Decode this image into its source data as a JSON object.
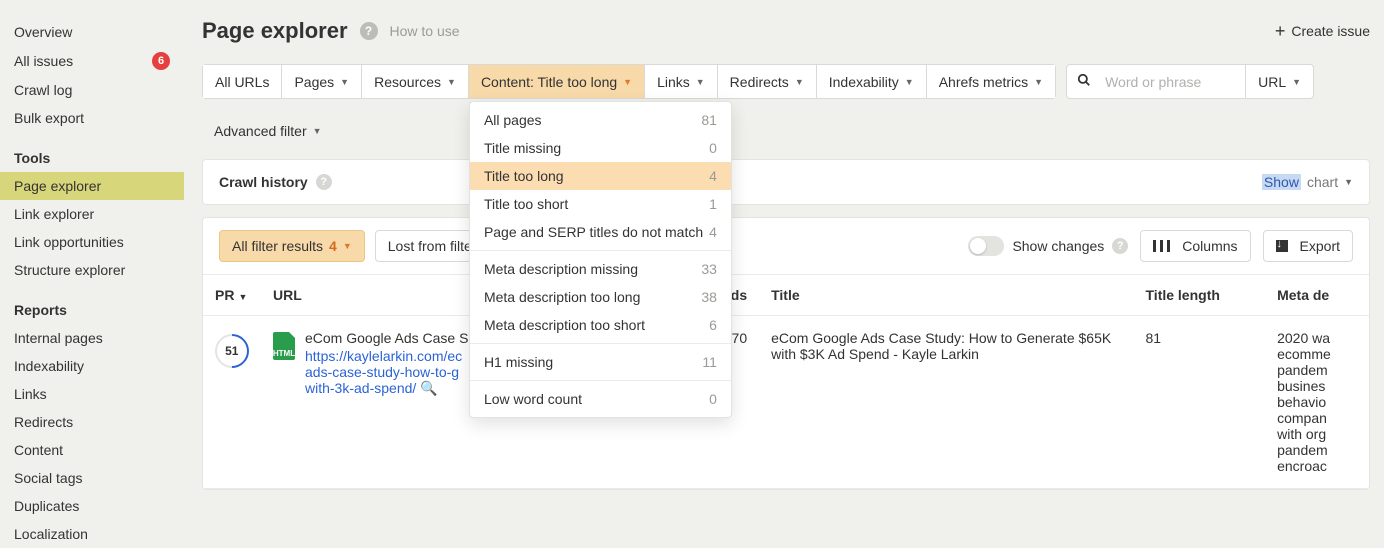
{
  "sidebar": {
    "top": [
      {
        "label": "Overview"
      },
      {
        "label": "All issues",
        "badge": 6
      },
      {
        "label": "Crawl log"
      },
      {
        "label": "Bulk export"
      }
    ],
    "tools_heading": "Tools",
    "tools": [
      {
        "label": "Page explorer",
        "active": true
      },
      {
        "label": "Link explorer"
      },
      {
        "label": "Link opportunities"
      },
      {
        "label": "Structure explorer"
      }
    ],
    "reports_heading": "Reports",
    "reports": [
      {
        "label": "Internal pages"
      },
      {
        "label": "Indexability"
      },
      {
        "label": "Links"
      },
      {
        "label": "Redirects"
      },
      {
        "label": "Content"
      },
      {
        "label": "Social tags"
      },
      {
        "label": "Duplicates"
      },
      {
        "label": "Localization"
      }
    ]
  },
  "header": {
    "title": "Page explorer",
    "how_to_use": "How to use",
    "create_issue": "Create issue"
  },
  "filters": {
    "all_urls": "All URLs",
    "pages": "Pages",
    "resources": "Resources",
    "content_selected": "Content: Title too long",
    "links": "Links",
    "redirects": "Redirects",
    "indexability": "Indexability",
    "ahrefs": "Ahrefs metrics",
    "search_placeholder": "Word or phrase",
    "url_label": "URL",
    "advanced": "Advanced filter"
  },
  "content_dropdown": [
    {
      "label": "All pages",
      "count": 81
    },
    {
      "label": "Title missing",
      "count": 0
    },
    {
      "label": "Title too long",
      "count": 4,
      "selected": true
    },
    {
      "label": "Title too short",
      "count": 1
    },
    {
      "label": "Page and SERP titles do not match",
      "count": 4
    },
    {
      "sep": true
    },
    {
      "label": "Meta description missing",
      "count": 33
    },
    {
      "label": "Meta description too long",
      "count": 38
    },
    {
      "label": "Meta description too short",
      "count": 6
    },
    {
      "sep": true
    },
    {
      "label": "H1 missing",
      "count": 11
    },
    {
      "sep": true
    },
    {
      "label": "Low word count",
      "count": 0
    }
  ],
  "crawl_history": {
    "label": "Crawl history",
    "show": "Show",
    "chart": "chart"
  },
  "toolbar": {
    "all_filter_results": "All filter results",
    "all_filter_count": 4,
    "lost_from_filter": "Lost from filter re",
    "show_changes": "Show changes",
    "columns": "Columns",
    "export": "Export"
  },
  "table": {
    "columns": {
      "pr": "PR",
      "url": "URL",
      "content_words_partial": "o. of content words",
      "title": "Title",
      "title_length": "Title length",
      "meta_partial": "Meta de"
    },
    "rows": [
      {
        "pr": 51,
        "page_title": "eCom Google Ads Case S",
        "url_display": "https://kaylelarkin.com/ec\nads-case-study-how-to-g\nwith-3k-ad-spend/",
        "content_words": "70",
        "title_full": "eCom Google Ads Case Study: How to Generate $65K with $3K Ad Spend - Kayle Larkin",
        "title_length": 81,
        "meta_preview": "2020 wa\necomme\npandem\nbusines\nbehavio\ncompan\nwith org\npandem\nencroac"
      }
    ]
  }
}
